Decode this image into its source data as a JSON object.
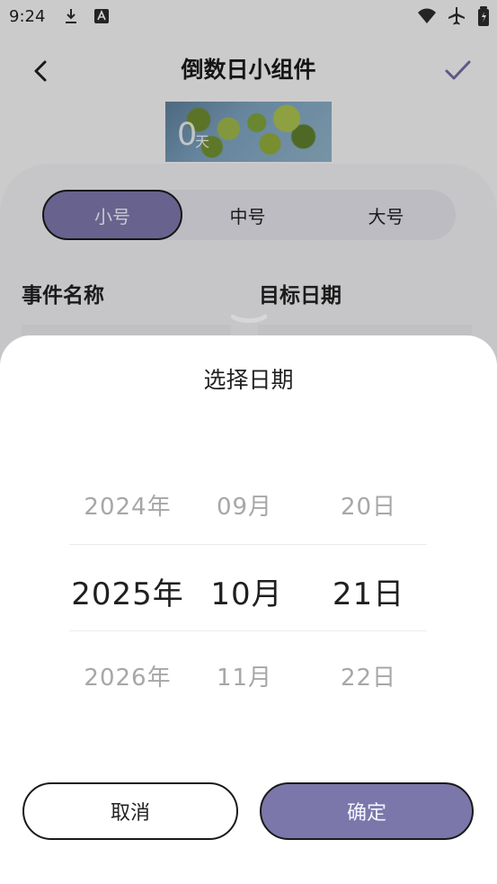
{
  "status_bar": {
    "time": "9:24",
    "icons": [
      "download-icon",
      "translate-icon",
      "wifi-icon",
      "airplane-icon",
      "battery-icon"
    ]
  },
  "header": {
    "title": "倒数日小组件",
    "back_icon": "back-arrow-icon",
    "confirm_icon": "check-icon"
  },
  "preview": {
    "days_value": "0",
    "days_unit": "天"
  },
  "size_tabs": {
    "items": [
      {
        "label": "小号"
      },
      {
        "label": "中号"
      },
      {
        "label": "大号"
      }
    ],
    "selected": "小号"
  },
  "form": {
    "event_name_label": "事件名称",
    "target_date_label": "目标日期"
  },
  "date_picker": {
    "title": "选择日期",
    "previous": {
      "year": "2024年",
      "month": "09月",
      "day": "20日"
    },
    "selected": {
      "year": "2025年",
      "month": "10月",
      "day": "21日"
    },
    "next": {
      "year": "2026年",
      "month": "11月",
      "day": "22日"
    },
    "cancel_label": "取消",
    "confirm_label": "确定"
  },
  "colors": {
    "accent": "#7b77aa",
    "panel": "#ececf0",
    "background": "#f3f2f4"
  }
}
